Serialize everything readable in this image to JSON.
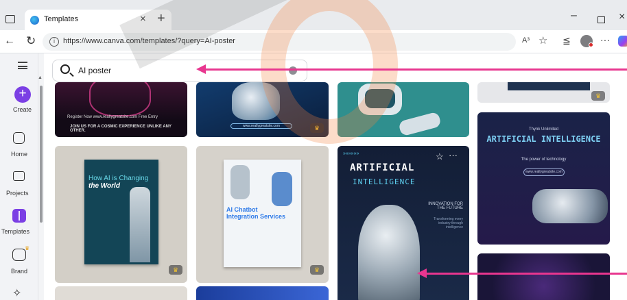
{
  "browser": {
    "tab_title": "Templates",
    "tab_close": "×",
    "new_tab": "+",
    "url": "https://www.canva.com/templates/?query=AI-poster",
    "read_aloud": "A³",
    "min": "–",
    "close": "×",
    "more": "···"
  },
  "sidebar": {
    "items": [
      {
        "label": "Create",
        "icon": "plus-icon"
      },
      {
        "label": "Home",
        "icon": "home-icon"
      },
      {
        "label": "Projects",
        "icon": "folder-icon"
      },
      {
        "label": "Templates",
        "icon": "templates-icon"
      },
      {
        "label": "Brand",
        "icon": "brand-icon"
      }
    ]
  },
  "search": {
    "value": "AI poster"
  },
  "cards": {
    "c1": {
      "line1": "Register Now    www.reallygreatsite.com    Free Entry",
      "line2": "JOIN US FOR A COSMIC EXPERIENCE UNLIKE ANY OTHER."
    },
    "c2": {
      "site": "www.reallygreatsite.com"
    },
    "c5": {
      "title_a": "How AI is Changing",
      "title_b": "the World"
    },
    "c6": {
      "title_a": "AI Chatbot",
      "title_b": "Integration Services"
    },
    "c7": {
      "heading1": "ARTIFICIAL",
      "heading2": "INTELLIGENCE",
      "sub1": "INNOVATION FOR THE FUTURE",
      "sub2": "Transforming every industry through intelligence"
    },
    "c8": {
      "t1": "Thynk Unlimited",
      "t2": "ARTIFICIAL INTELLIGENCE",
      "t3": "The power of technology",
      "pill": "www.reallygreatsite.com"
    }
  },
  "colors": {
    "accent": "#7b3fe4",
    "annotation_arrow": "#e8368f",
    "watermark": "#f5823c"
  }
}
